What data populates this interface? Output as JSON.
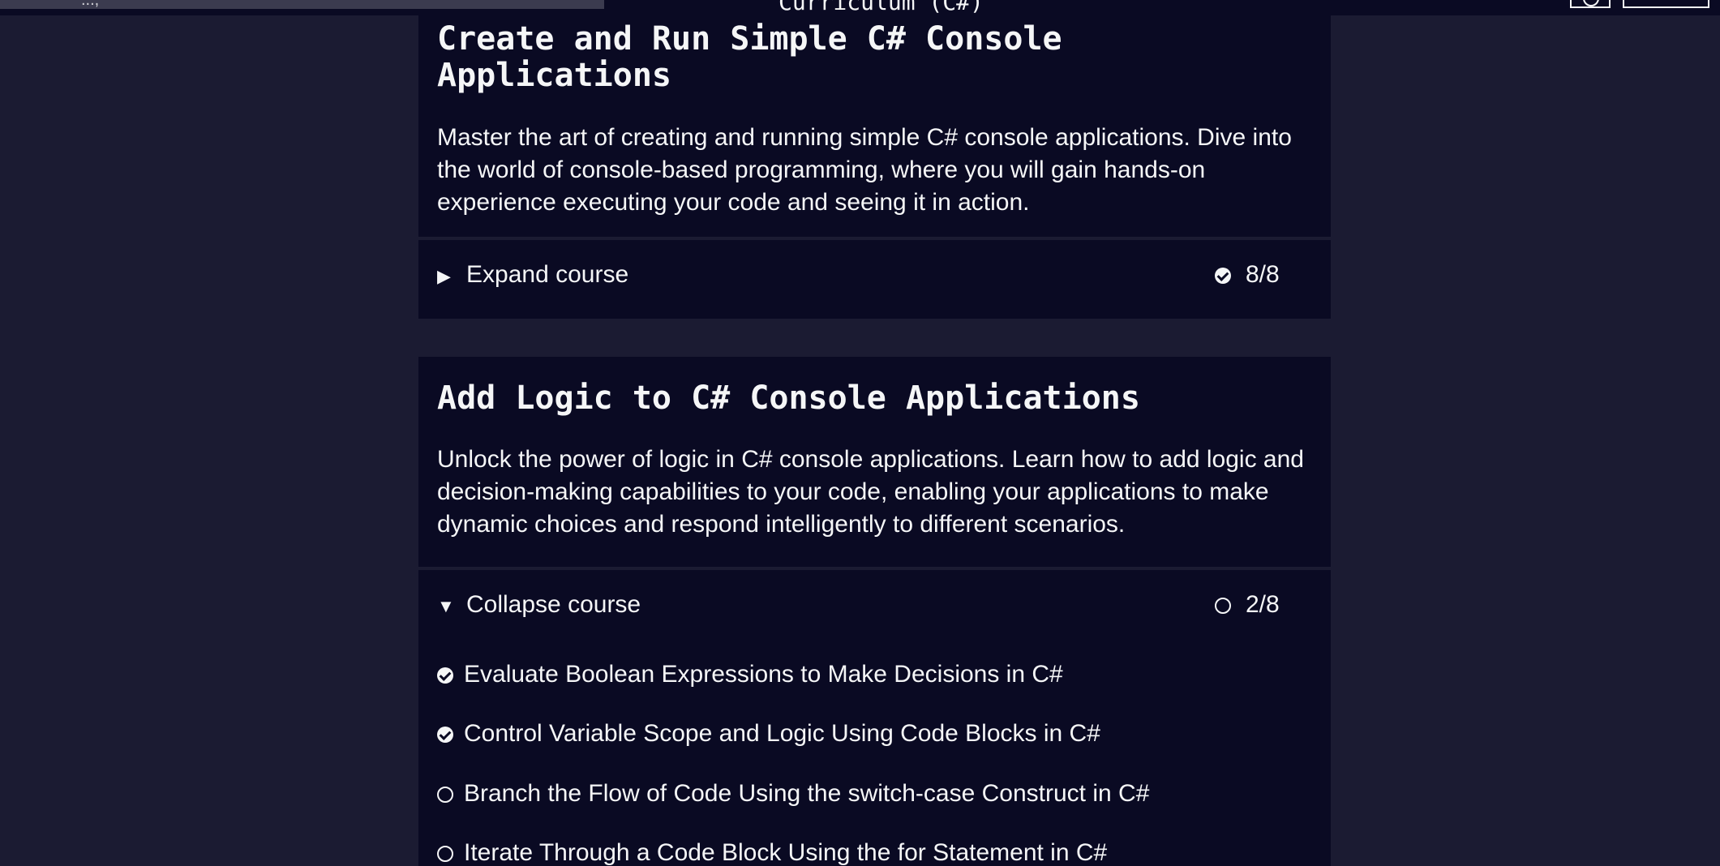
{
  "nav": {
    "search_value": "...,",
    "center_text": "Curriculum (C#)"
  },
  "courses": [
    {
      "title": "Create and Run Simple C# Console Applications",
      "description": "Master the art of creating and running simple C# console applications. Dive into the world of console-based programming, where you will gain hands-on experience executing your code and seeing it in action.",
      "toggle_label": "Expand course",
      "progress": "8/8",
      "complete": true
    },
    {
      "title": "Add Logic to C# Console Applications",
      "description": "Unlock the power of logic in C# console applications. Learn how to add logic and decision-making capabilities to your code, enabling your applications to make dynamic choices and respond intelligently to different scenarios.",
      "toggle_label": "Collapse course",
      "progress": "2/8",
      "complete": false,
      "blocks": [
        {
          "label": "Evaluate Boolean Expressions to Make Decisions in C#",
          "complete": true
        },
        {
          "label": "Control Variable Scope and Logic Using Code Blocks in C#",
          "complete": true
        },
        {
          "label": "Branch the Flow of Code Using the switch-case Construct in C#",
          "complete": false
        },
        {
          "label": "Iterate Through a Code Block Using the for Statement in C#",
          "complete": false
        }
      ]
    }
  ]
}
